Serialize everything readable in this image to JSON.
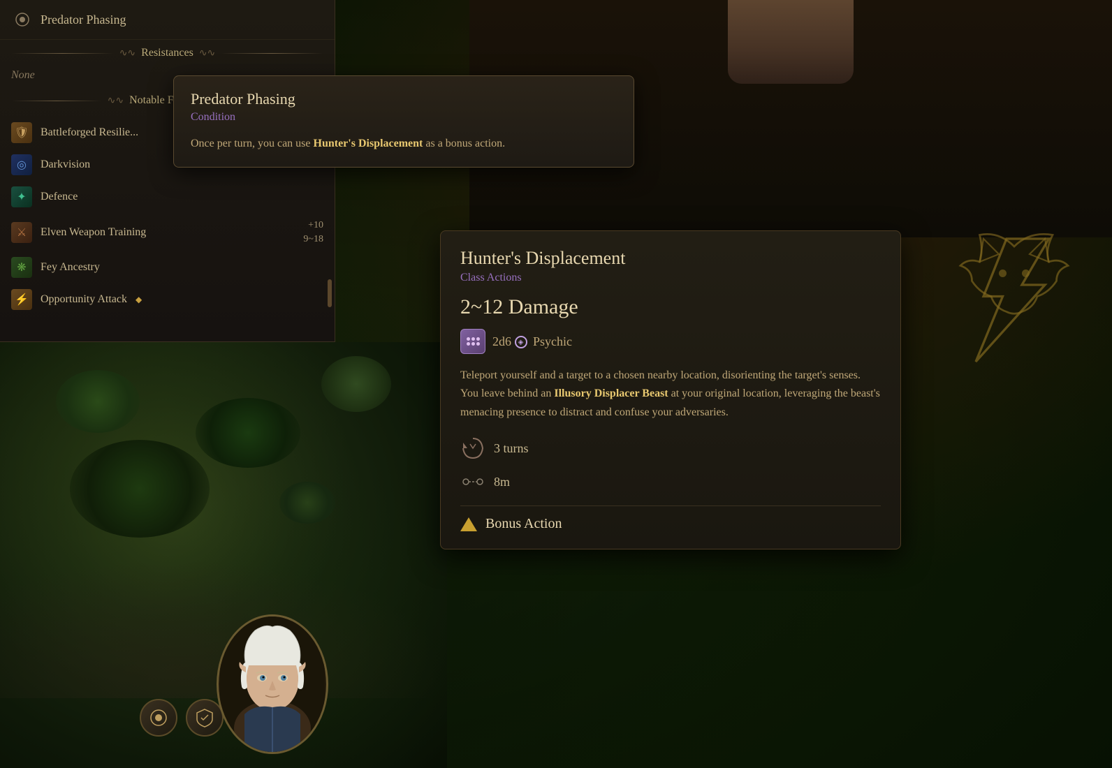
{
  "app": {
    "title": "Predator Phasing"
  },
  "left_panel": {
    "header": {
      "icon": "⊙",
      "title": "Predator Phasing"
    },
    "resistances_section": {
      "label": "Resistances",
      "value": "None"
    },
    "notable_features_section": {
      "label": "Notable Features"
    },
    "features": [
      {
        "id": "battleforged",
        "name": "Battleforged Resilie...",
        "icon_type": "bronze",
        "icon": "🛡"
      },
      {
        "id": "darkvision",
        "name": "Darkvision",
        "icon_type": "blue",
        "icon": "◎"
      },
      {
        "id": "defence",
        "name": "Defence",
        "icon_type": "teal",
        "icon": "✦"
      },
      {
        "id": "elven_weapon_training",
        "name": "Elven Weapon Training",
        "icon_type": "brown",
        "icon": "⚔",
        "stat1": "+10",
        "stat2": "9~18"
      },
      {
        "id": "fey_ancestry",
        "name": "Fey Ancestry",
        "icon_type": "green",
        "icon": "❋"
      },
      {
        "id": "opportunity_attack",
        "name": "Opportunity Attack",
        "icon_type": "bronze",
        "icon": "⚡"
      }
    ]
  },
  "tooltip_predator": {
    "title": "Predator Phasing",
    "type": "Condition",
    "body_prefix": "Once per turn, you can use ",
    "link_text": "Hunter's Displacement",
    "body_suffix": " as a bonus action."
  },
  "hunters_displacement": {
    "title": "Hunter's Displacement",
    "type": "Class Actions",
    "damage": "2~12 Damage",
    "dice": "2d6",
    "damage_type": "Psychic",
    "description_prefix": "Teleport yourself and a target to a chosen nearby location, disorienting the target's senses. You leave behind an ",
    "link_text": "Illusory Displacer Beast",
    "description_suffix": " at your original location, leveraging the beast's menacing presence to distract and confuse your adversaries.",
    "turns": "3 turns",
    "range": "8m",
    "action_type": "Bonus Action"
  },
  "hud": {
    "btn1": "⊙",
    "btn2": "🛡"
  }
}
